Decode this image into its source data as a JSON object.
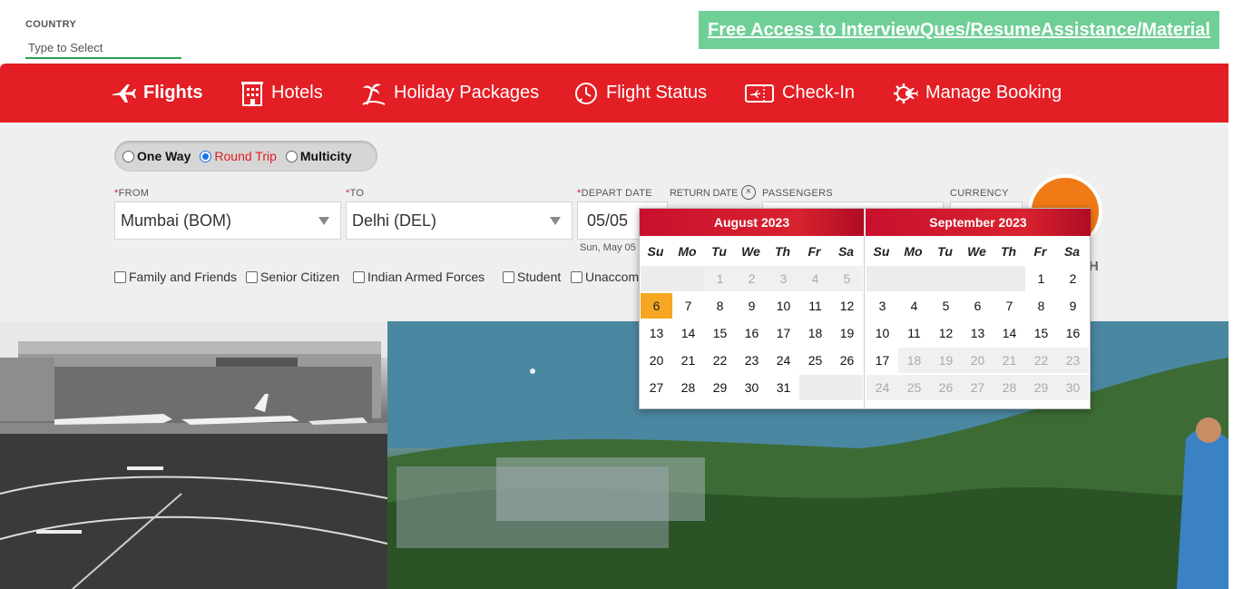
{
  "top": {
    "country_label": "COUNTRY",
    "country_placeholder": "Type to Select",
    "promo_link": "Free Access to InterviewQues/ResumeAssistance/Material"
  },
  "nav": {
    "flights": "Flights",
    "hotels": "Hotels",
    "holiday": "Holiday Packages",
    "flight_status": "Flight Status",
    "checkin": "Check-In",
    "manage": "Manage Booking"
  },
  "trip": {
    "one_way": "One Way",
    "round_trip": "Round Trip",
    "multicity": "Multicity",
    "selected": "Round Trip"
  },
  "form": {
    "from_label": "FROM",
    "from_value": "Mumbai (BOM)",
    "to_label": "TO",
    "to_value": "Delhi (DEL)",
    "depart_label": "DEPART DATE",
    "depart_value": "05/05",
    "depart_sub": "Sun, May 05",
    "return_label": "RETURN DATE",
    "passengers_label": "PASSENGERS",
    "currency_label": "CURRENCY",
    "search_partial": "H"
  },
  "options": {
    "family": "Family and Friends",
    "senior": "Senior Citizen",
    "armed": "Indian Armed Forces",
    "student": "Student",
    "unaccompanied": "Unaccom"
  },
  "calendar": {
    "weekdays": [
      "Su",
      "Mo",
      "Tu",
      "We",
      "Th",
      "Fr",
      "Sa"
    ],
    "months": [
      {
        "title": "August 2023",
        "lead_blank": 2,
        "days": 31,
        "disabled_until": 5,
        "disabled_from": 99,
        "selected": 6,
        "trail_fill": true
      },
      {
        "title": "September 2023",
        "lead_blank": 5,
        "days": 30,
        "disabled_until": 0,
        "disabled_from": 18,
        "selected": 0,
        "trail_fill": false
      }
    ]
  },
  "colors": {
    "brand_red": "#e31e24",
    "promo_green": "#6fcf97",
    "selected_day": "#f5a623",
    "search_orange": "#f07a16"
  }
}
